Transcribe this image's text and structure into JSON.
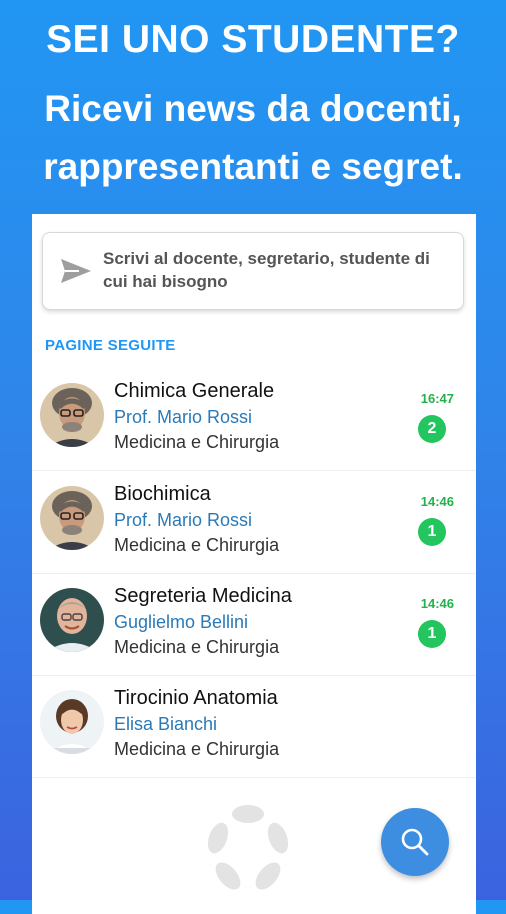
{
  "hero": {
    "line1": "SEI UNO STUDENTE?",
    "line2": "Ricevi news da docenti,",
    "line3": "rappresentanti e segret."
  },
  "compose": {
    "icon": "send-icon",
    "text": "Scrivi al docente, segretario, studente di cui hai bisogno"
  },
  "section": {
    "title": "PAGINE SEGUITE"
  },
  "pages": [
    {
      "title": "Chimica Generale",
      "person": "Prof. Mario Rossi",
      "faculty": "Medicina e Chirurgia",
      "time": "16:47",
      "unread": "2"
    },
    {
      "title": "Biochimica",
      "person": "Prof. Mario Rossi",
      "faculty": "Medicina e Chirurgia",
      "time": "14:46",
      "unread": "1"
    },
    {
      "title": "Segreteria Medicina",
      "person": "Guglielmo  Bellini",
      "faculty": "Medicina e Chirurgia",
      "time": "14:46",
      "unread": "1"
    },
    {
      "title": "Tirocinio Anatomia",
      "person": "Elisa Bianchi",
      "faculty": "Medicina e Chirurgia",
      "time": "",
      "unread": ""
    }
  ],
  "fab": {
    "icon": "search-icon"
  },
  "colors": {
    "accent": "#2196f3",
    "badge": "#22c55e",
    "time": "#22b14c",
    "fab": "#3d8ee0"
  }
}
